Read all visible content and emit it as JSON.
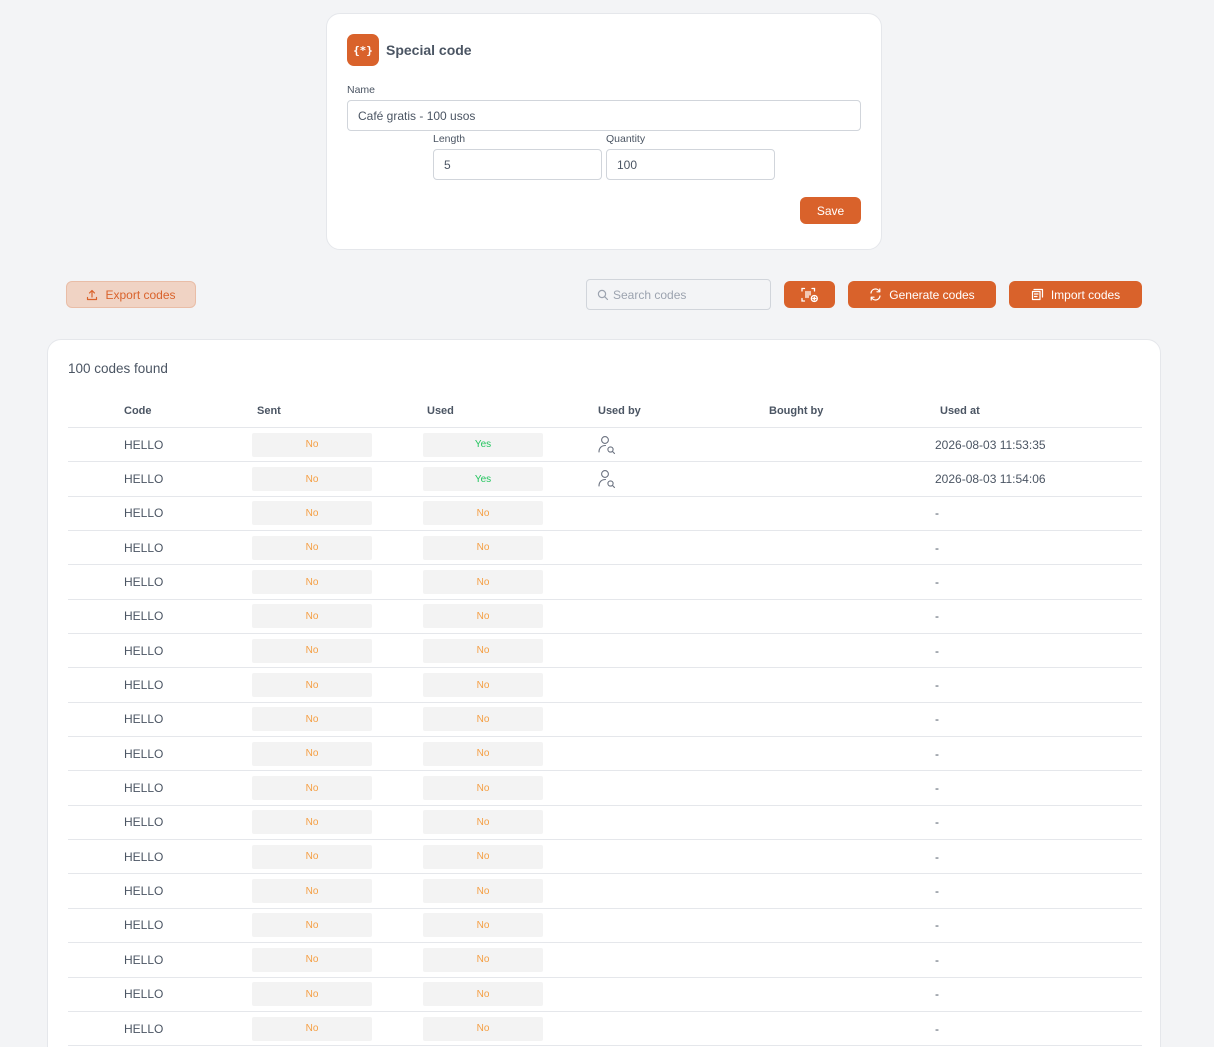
{
  "form": {
    "icon_text": "{*}",
    "title": "Special code",
    "name_label": "Name",
    "name_value": "Café gratis - 100 usos",
    "length_label": "Length",
    "length_value": "5",
    "quantity_label": "Quantity",
    "quantity_value": "100",
    "save_label": "Save"
  },
  "toolbar": {
    "export_label": "Export codes",
    "search_placeholder": "Search codes",
    "generate_label": "Generate codes",
    "import_label": "Import codes"
  },
  "colors": {
    "accent": "#d9622b",
    "yes": "#22c55e",
    "no": "#f59e42"
  },
  "results": {
    "count_text": "100 codes found",
    "columns": [
      "Code",
      "Sent",
      "Used",
      "Used by",
      "Bought by",
      "Used at"
    ],
    "rows": [
      {
        "code": "HELLO",
        "sent": "No",
        "used": "Yes",
        "used_by_icon": true,
        "bought_by": "",
        "used_at": "2026-08-03 11:53:35"
      },
      {
        "code": "HELLO",
        "sent": "No",
        "used": "Yes",
        "used_by_icon": true,
        "bought_by": "",
        "used_at": "2026-08-03 11:54:06"
      },
      {
        "code": "HELLO",
        "sent": "No",
        "used": "No",
        "used_by_icon": false,
        "bought_by": "",
        "used_at": "-"
      },
      {
        "code": "HELLO",
        "sent": "No",
        "used": "No",
        "used_by_icon": false,
        "bought_by": "",
        "used_at": "-"
      },
      {
        "code": "HELLO",
        "sent": "No",
        "used": "No",
        "used_by_icon": false,
        "bought_by": "",
        "used_at": "-"
      },
      {
        "code": "HELLO",
        "sent": "No",
        "used": "No",
        "used_by_icon": false,
        "bought_by": "",
        "used_at": "-"
      },
      {
        "code": "HELLO",
        "sent": "No",
        "used": "No",
        "used_by_icon": false,
        "bought_by": "",
        "used_at": "-"
      },
      {
        "code": "HELLO",
        "sent": "No",
        "used": "No",
        "used_by_icon": false,
        "bought_by": "",
        "used_at": "-"
      },
      {
        "code": "HELLO",
        "sent": "No",
        "used": "No",
        "used_by_icon": false,
        "bought_by": "",
        "used_at": "-"
      },
      {
        "code": "HELLO",
        "sent": "No",
        "used": "No",
        "used_by_icon": false,
        "bought_by": "",
        "used_at": "-"
      },
      {
        "code": "HELLO",
        "sent": "No",
        "used": "No",
        "used_by_icon": false,
        "bought_by": "",
        "used_at": "-"
      },
      {
        "code": "HELLO",
        "sent": "No",
        "used": "No",
        "used_by_icon": false,
        "bought_by": "",
        "used_at": "-"
      },
      {
        "code": "HELLO",
        "sent": "No",
        "used": "No",
        "used_by_icon": false,
        "bought_by": "",
        "used_at": "-"
      },
      {
        "code": "HELLO",
        "sent": "No",
        "used": "No",
        "used_by_icon": false,
        "bought_by": "",
        "used_at": "-"
      },
      {
        "code": "HELLO",
        "sent": "No",
        "used": "No",
        "used_by_icon": false,
        "bought_by": "",
        "used_at": "-"
      },
      {
        "code": "HELLO",
        "sent": "No",
        "used": "No",
        "used_by_icon": false,
        "bought_by": "",
        "used_at": "-"
      },
      {
        "code": "HELLO",
        "sent": "No",
        "used": "No",
        "used_by_icon": false,
        "bought_by": "",
        "used_at": "-"
      },
      {
        "code": "HELLO",
        "sent": "No",
        "used": "No",
        "used_by_icon": false,
        "bought_by": "",
        "used_at": "-"
      }
    ]
  }
}
